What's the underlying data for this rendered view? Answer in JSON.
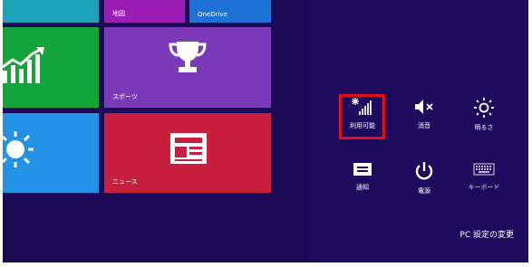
{
  "tiles": {
    "map_label": "地図",
    "onedrive_label": "OneDrive",
    "sports_label": "スポーツ",
    "news_label": "ニュース"
  },
  "quick_settings": {
    "network": {
      "label": "利用可能",
      "icon": "network-signal-icon"
    },
    "volume": {
      "label": "消音",
      "icon": "speaker-muted-icon"
    },
    "brightness": {
      "label": "明るさ",
      "icon": "brightness-sun-icon"
    },
    "notifications": {
      "label": "通知",
      "icon": "notification-icon"
    },
    "power": {
      "label": "電源",
      "icon": "power-icon"
    },
    "keyboard": {
      "label": "キーボード",
      "icon": "keyboard-icon"
    }
  },
  "pc_settings_link": "PC 設定の変更",
  "colors": {
    "start_background": "#1a0a58",
    "panel_background": "#1d0b5e",
    "highlight_border": "#e0101a",
    "tile_green": "#14a53a",
    "tile_purple": "#7b3bb8",
    "tile_blue": "#2392e6",
    "tile_red": "#c71f3d"
  }
}
